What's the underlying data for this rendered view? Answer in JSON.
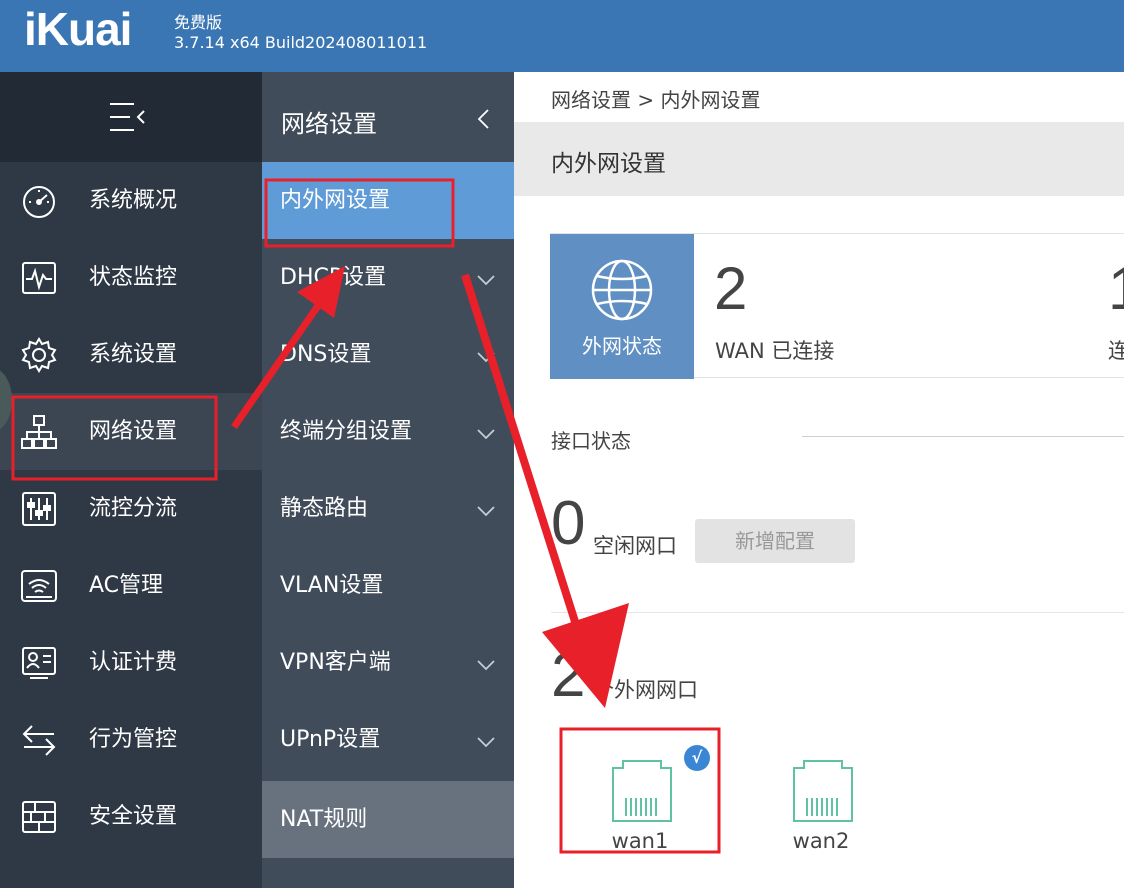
{
  "header": {
    "logo": "iKuai",
    "edition": "免费版",
    "version": "3.7.14 x64 Build202408011011"
  },
  "sidebar": {
    "items": [
      {
        "label": "系统概况",
        "icon": "speedometer-icon"
      },
      {
        "label": "状态监控",
        "icon": "pulse-monitor-icon"
      },
      {
        "label": "系统设置",
        "icon": "gear-icon"
      },
      {
        "label": "网络设置",
        "icon": "network-tree-icon"
      },
      {
        "label": "流控分流",
        "icon": "sliders-icon"
      },
      {
        "label": "AC管理",
        "icon": "wifi-icon"
      },
      {
        "label": "认证计费",
        "icon": "id-card-icon"
      },
      {
        "label": "行为管控",
        "icon": "swap-arrows-icon"
      },
      {
        "label": "安全设置",
        "icon": "brick-wall-icon"
      }
    ],
    "active_index": 3
  },
  "submenu": {
    "title": "网络设置",
    "items": [
      {
        "label": "内外网设置",
        "has_chevron": false
      },
      {
        "label": "DHCP设置",
        "has_chevron": true
      },
      {
        "label": "DNS设置",
        "has_chevron": true
      },
      {
        "label": "终端分组设置",
        "has_chevron": true
      },
      {
        "label": "静态路由",
        "has_chevron": true
      },
      {
        "label": "VLAN设置",
        "has_chevron": false
      },
      {
        "label": "VPN客户端",
        "has_chevron": true
      },
      {
        "label": "UPnP设置",
        "has_chevron": true
      },
      {
        "label": "NAT规则",
        "has_chevron": false
      }
    ],
    "active_index": 0
  },
  "main": {
    "breadcrumb": "网络设置 > 内外网设置",
    "page_title": "内外网设置",
    "wan_status": {
      "box_label": "外网状态",
      "count": "2",
      "connected_text": "WAN 已连接",
      "next_count_fragment": "1",
      "next_label_fragment": "连"
    },
    "interface_status_label": "接口状态",
    "idle": {
      "count": "0",
      "label": "空闲网口",
      "add_button": "新增配置"
    },
    "external": {
      "count": "2",
      "label": "个外网网口"
    },
    "ports": [
      {
        "label": "wan1",
        "selected": true
      },
      {
        "label": "wan2",
        "selected": false
      }
    ]
  },
  "colors": {
    "header": "#3a76b4",
    "sidebar": "#2f3845",
    "submenu": "#414c5a",
    "submenu_active": "#5f9bd6",
    "wan_box": "#5f8fc3",
    "port_green": "#5fc2a2",
    "annotation_red": "#e8202a"
  }
}
